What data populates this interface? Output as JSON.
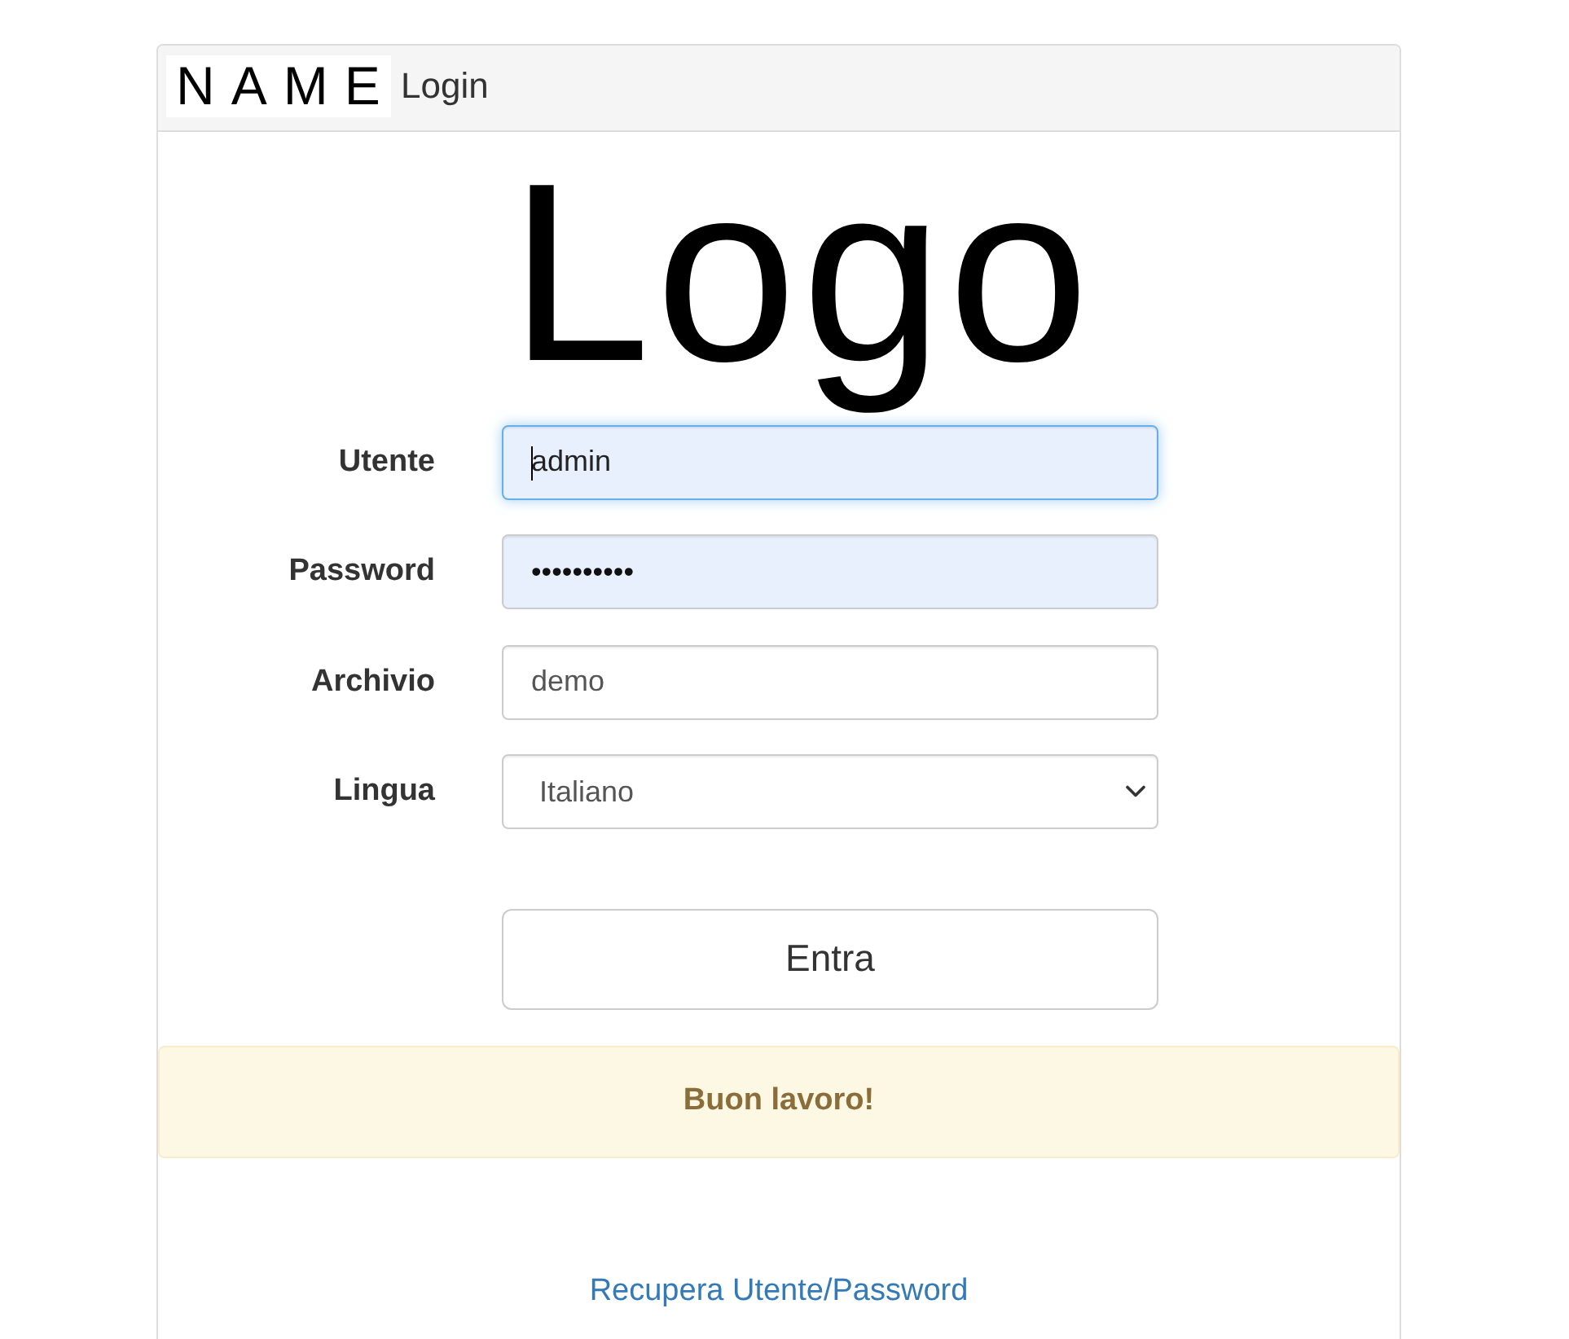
{
  "header": {
    "brand": "NAME",
    "title": "Login"
  },
  "logo": "Logo",
  "form": {
    "fields": [
      {
        "kind": "text",
        "label": "Utente",
        "value": "admin",
        "focused": true,
        "autofilled": true
      },
      {
        "kind": "password",
        "label": "Password",
        "value": "••••••••••",
        "focused": false,
        "autofilled": true
      },
      {
        "kind": "text",
        "label": "Archivio",
        "value": "demo",
        "focused": false,
        "autofilled": false
      },
      {
        "kind": "select",
        "label": "Lingua",
        "value": "Italiano",
        "focused": false,
        "autofilled": false
      }
    ],
    "submit_button": "Entra"
  },
  "alert": {
    "text": "Buon lavoro!"
  },
  "recover_link": "Recupera Utente/Password"
}
